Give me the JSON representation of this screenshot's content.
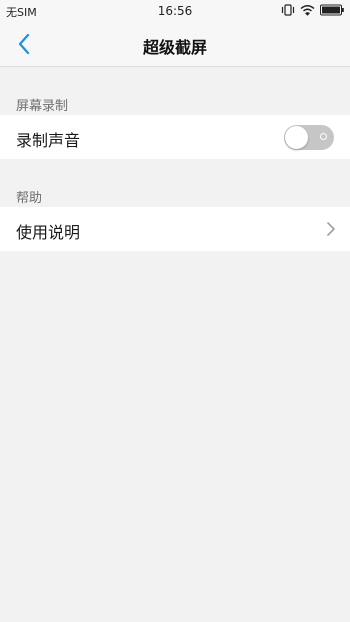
{
  "status_bar": {
    "carrier": "无SIM",
    "time": "16:56",
    "icons": [
      "vibrate-icon",
      "wifi-icon",
      "battery-icon"
    ]
  },
  "nav": {
    "title": "超级截屏",
    "back_icon": "chevron-left-icon"
  },
  "sections": [
    {
      "header": "屏幕录制",
      "rows": [
        {
          "label": "录制声音",
          "control": "toggle",
          "value": "off"
        }
      ]
    },
    {
      "header": "帮助",
      "rows": [
        {
          "label": "使用说明",
          "control": "chevron-right-icon"
        }
      ]
    }
  ],
  "colors": {
    "accent": "#1e90d8",
    "background": "#f2f2f2",
    "row_background": "#ffffff",
    "toggle_off": "#c6c6c6",
    "section_header_text": "#6f6f6f"
  }
}
